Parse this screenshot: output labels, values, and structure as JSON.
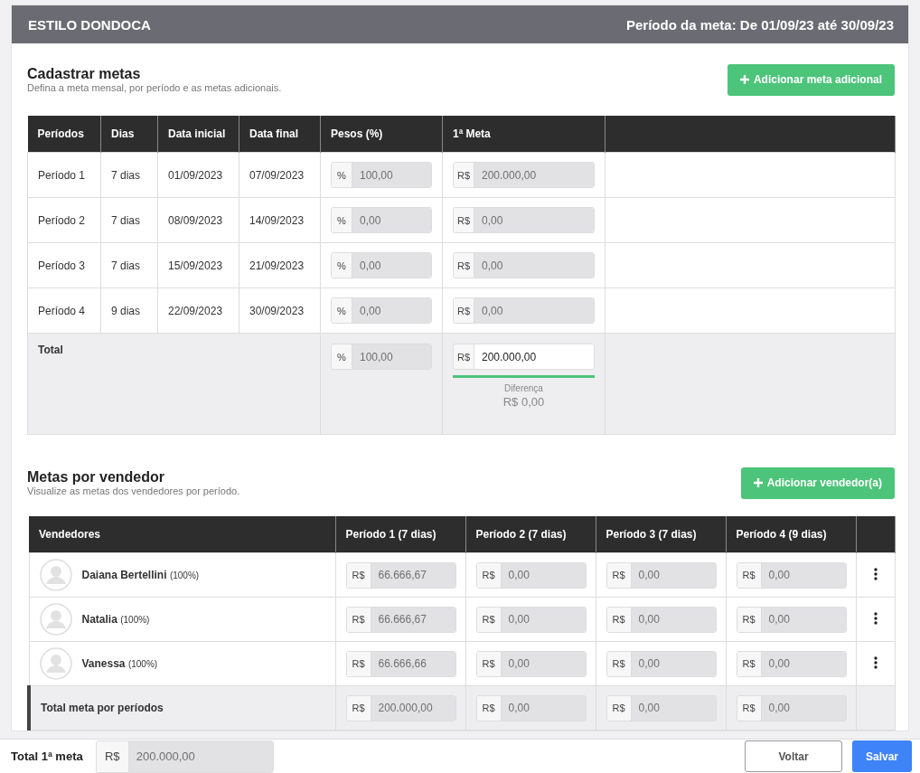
{
  "header": {
    "store": "ESTILO DONDOCA",
    "period": "Período da meta: De 01/09/23 até 30/09/23"
  },
  "metas": {
    "title": "Cadastrar metas",
    "subtitle": "Defina a meta mensal, por período e as metas adicionais.",
    "add_button": "Adicionar meta adicional",
    "columns": [
      "Períodos",
      "Dias",
      "Data inicial",
      "Data final",
      "Pesos (%)",
      "1ª Meta"
    ],
    "rows": [
      {
        "period": "Período 1",
        "days": "7 dias",
        "start": "01/09/2023",
        "end": "07/09/2023",
        "weight": {
          "prefix": "%",
          "value": "100,00",
          "disabled": true
        },
        "goal": {
          "prefix": "R$",
          "value": "200.000,00",
          "disabled": true
        }
      },
      {
        "period": "Período 2",
        "days": "7 dias",
        "start": "08/09/2023",
        "end": "14/09/2023",
        "weight": {
          "prefix": "%",
          "value": "0,00",
          "disabled": true
        },
        "goal": {
          "prefix": "R$",
          "value": "0,00",
          "disabled": true
        }
      },
      {
        "period": "Período 3",
        "days": "7 dias",
        "start": "15/09/2023",
        "end": "21/09/2023",
        "weight": {
          "prefix": "%",
          "value": "0,00",
          "disabled": true
        },
        "goal": {
          "prefix": "R$",
          "value": "0,00",
          "disabled": true
        }
      },
      {
        "period": "Período 4",
        "days": "9 dias",
        "start": "22/09/2023",
        "end": "30/09/2023",
        "weight": {
          "prefix": "%",
          "value": "0,00",
          "disabled": true
        },
        "goal": {
          "prefix": "R$",
          "value": "0,00",
          "disabled": true
        }
      }
    ],
    "total": {
      "label": "Total",
      "weight": {
        "prefix": "%",
        "value": "100,00",
        "disabled": true
      },
      "goal": {
        "prefix": "R$",
        "value": "200.000,00",
        "disabled": false
      },
      "level": 1,
      "difference_label": "Diferença",
      "difference_value": "R$ 0,00"
    }
  },
  "vendors": {
    "title": "Metas por vendedor",
    "subtitle": "Visualize as metas dos vendedores por período.",
    "add_button": "Adicionar vendedor(a)",
    "seller_column": "Vendedores",
    "period_columns": [
      "Período 1 (7 dias)",
      "Período 2 (7 dias)",
      "Período 3 (7 dias)",
      "Período 4 (9 dias)"
    ],
    "rows": [
      {
        "seller": {
          "name": "Daiana Bertellini",
          "share": "(100%)"
        },
        "periods": [
          {
            "prefix": "R$",
            "value": "66.666,67",
            "disabled": true
          },
          {
            "prefix": "R$",
            "value": "0,00",
            "disabled": true
          },
          {
            "prefix": "R$",
            "value": "0,00",
            "disabled": true
          },
          {
            "prefix": "R$",
            "value": "0,00",
            "disabled": true
          }
        ]
      },
      {
        "seller": {
          "name": "Natalia",
          "share": "(100%)"
        },
        "periods": [
          {
            "prefix": "R$",
            "value": "66.666,67",
            "disabled": true
          },
          {
            "prefix": "R$",
            "value": "0,00",
            "disabled": true
          },
          {
            "prefix": "R$",
            "value": "0,00",
            "disabled": true
          },
          {
            "prefix": "R$",
            "value": "0,00",
            "disabled": true
          }
        ]
      },
      {
        "seller": {
          "name": "Vanessa",
          "share": "(100%)"
        },
        "periods": [
          {
            "prefix": "R$",
            "value": "66.666,66",
            "disabled": true
          },
          {
            "prefix": "R$",
            "value": "0,00",
            "disabled": true
          },
          {
            "prefix": "R$",
            "value": "0,00",
            "disabled": true
          },
          {
            "prefix": "R$",
            "value": "0,00",
            "disabled": true
          }
        ]
      }
    ],
    "total": {
      "label": "Total meta por períodos",
      "periods": [
        {
          "prefix": "R$",
          "value": "200.000,00",
          "disabled": true
        },
        {
          "prefix": "R$",
          "value": "0,00",
          "disabled": true
        },
        {
          "prefix": "R$",
          "value": "0,00",
          "disabled": true
        },
        {
          "prefix": "R$",
          "value": "0,00",
          "disabled": true
        }
      ]
    }
  },
  "footer": {
    "label": "Total 1ª meta",
    "field": {
      "prefix": "R$",
      "value": "200.000,00",
      "disabled": true
    },
    "buttons": [
      {
        "label": "Voltar",
        "kind": "secondary"
      },
      {
        "label": "Salvar",
        "kind": "primary"
      }
    ]
  }
}
